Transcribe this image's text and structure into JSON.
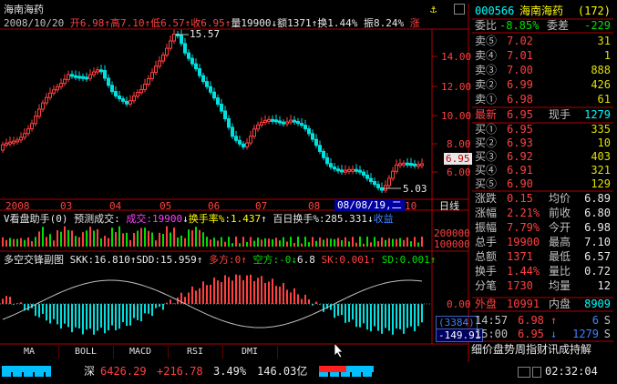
{
  "header": {
    "name": "海南海药",
    "date": "2008/10/20",
    "open": "开6.98",
    "high": "高7.10",
    "low": "低6.57",
    "close": "收6.95",
    "volume": "量19900",
    "amount": "额1371",
    "turnover": "换1.44%",
    "amplitude": "振8.24%",
    "trend": "涨"
  },
  "price_axis": [
    "14.00",
    "12.00",
    "10.00",
    "8.00",
    "6.95",
    "6.00"
  ],
  "annotations": {
    "high_mark": "15.57",
    "low_mark": "5.03"
  },
  "time_axis": [
    "2008",
    "03",
    "04",
    "05",
    "06",
    "07",
    "08",
    "10"
  ],
  "cursor_date": "08/08/19,二",
  "period": "日线",
  "vol_panel": {
    "title": "V看盘助手(0) 预测成交:",
    "vol_label": "成交:19900",
    "turn_label": "换手率%:1.437",
    "hundred_label": "百日换手%:285.331",
    "gain_label": "收益",
    "axis": [
      "200000",
      "100000"
    ]
  },
  "macd_panel": {
    "title": "多空交锋副图",
    "skk": "SKK:16.810",
    "sdd": "SDD:15.959",
    "dk": "多方:0",
    "kf": "空方:-0",
    "v": "6.8",
    "sk": "SK:0.001",
    "sd": "SD:0.001",
    "axis_zero": "0.00",
    "box1": "(3384)",
    "box2": "-149.91"
  },
  "tabs": [
    "MA",
    "BOLL",
    "MACD",
    "RSI",
    "DMI"
  ],
  "quote": {
    "code": "000566",
    "name": "海南海药",
    "count": "(172)",
    "weibi_label": "委比",
    "weibi": "-8.85%",
    "weicha_label": "委差",
    "weicha": "-229",
    "sells": [
      {
        "label": "卖⑤",
        "price": "7.02",
        "vol": "31"
      },
      {
        "label": "卖④",
        "price": "7.01",
        "vol": "1"
      },
      {
        "label": "卖③",
        "price": "7.00",
        "vol": "888"
      },
      {
        "label": "卖②",
        "price": "6.99",
        "vol": "426"
      },
      {
        "label": "卖①",
        "price": "6.98",
        "vol": "61"
      }
    ],
    "last_label": "最新",
    "last": "6.95",
    "xianshou_label": "现手",
    "xianshou": "1279",
    "buys": [
      {
        "label": "买①",
        "price": "6.95",
        "vol": "335"
      },
      {
        "label": "买②",
        "price": "6.93",
        "vol": "10"
      },
      {
        "label": "买③",
        "price": "6.92",
        "vol": "403"
      },
      {
        "label": "买④",
        "price": "6.91",
        "vol": "321"
      },
      {
        "label": "买⑤",
        "price": "6.90",
        "vol": "129"
      }
    ],
    "stats": [
      {
        "l1": "涨跌",
        "v1": "0.15",
        "l2": "均价",
        "v2": "6.89"
      },
      {
        "l1": "涨幅",
        "v1": "2.21%",
        "l2": "前收",
        "v2": "6.80"
      },
      {
        "l1": "振幅",
        "v1": "7.79%",
        "l2": "今开",
        "v2": "6.98"
      },
      {
        "l1": "总手",
        "v1": "19900",
        "l2": "最高",
        "v2": "7.10"
      },
      {
        "l1": "总额",
        "v1": "1371",
        "l2": "最低",
        "v2": "6.57"
      },
      {
        "l1": "换手",
        "v1": "1.44%",
        "l2": "量比",
        "v2": "0.72"
      },
      {
        "l1": "分笔",
        "v1": "1730",
        "l2": "均量",
        "v2": "12"
      }
    ],
    "outer_label": "外盘",
    "outer": "10991",
    "inner_label": "内盘",
    "inner": "8909",
    "ticks": [
      {
        "time": "14:57",
        "price": "6.98",
        "vol": "6",
        "dir": "S"
      },
      {
        "time": "15:00",
        "price": "6.95",
        "vol": "1279",
        "dir": "S"
      }
    ],
    "bottom_tabs": "细价盘势周指财讯成持解"
  },
  "statusbar": {
    "index_name": "深",
    "index": "6426.29",
    "change": "+216.78",
    "pct": "3.49%",
    "amount": "146.03亿",
    "clock": "02:32:04"
  },
  "colors": {
    "up": "#ff4040",
    "down": "#00e0e0",
    "frame": "#b00000",
    "bg": "#000000"
  }
}
